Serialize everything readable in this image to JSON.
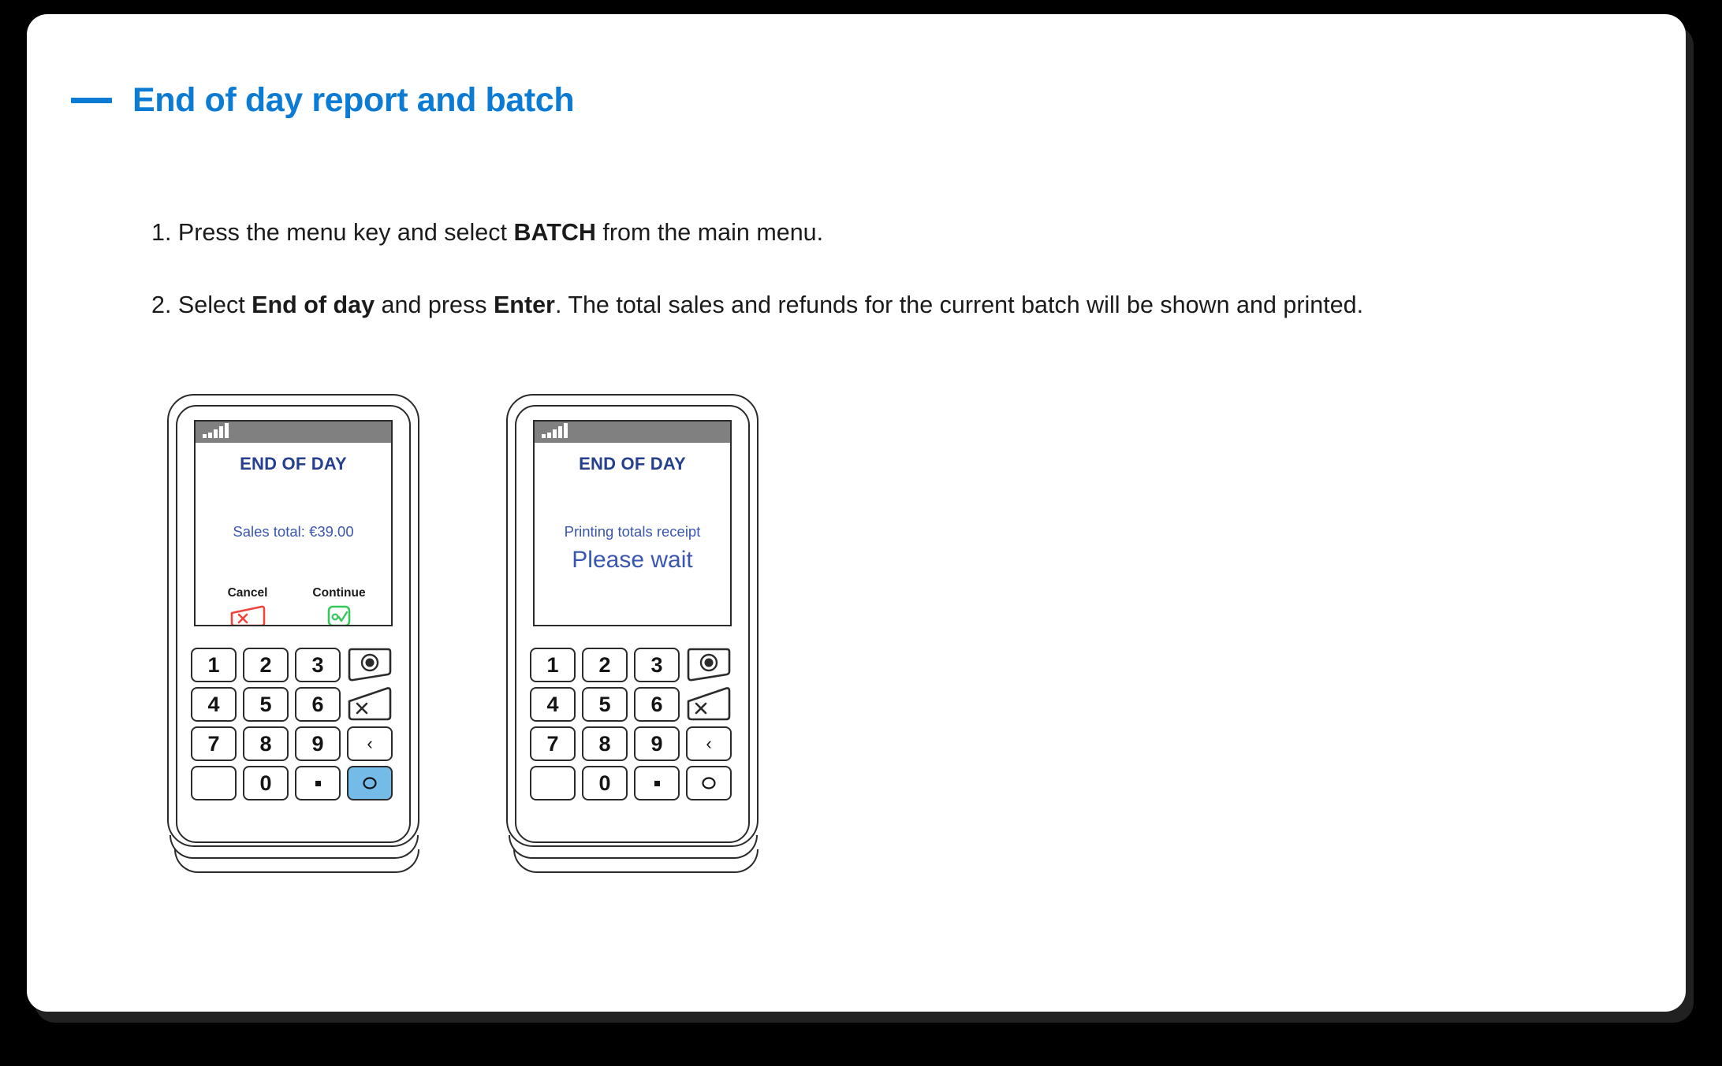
{
  "page": {
    "heading": "End of day report and batch",
    "accent_color": "#0b7bd4",
    "steps": [
      {
        "id": "step-1",
        "parts": [
          {
            "text": "1. Press the menu key and select ",
            "bold": false
          },
          {
            "text": "BATCH",
            "bold": true
          },
          {
            "text": " from the main menu.",
            "bold": false
          }
        ]
      },
      {
        "id": "step-2",
        "parts": [
          {
            "text": "2. Select ",
            "bold": false
          },
          {
            "text": "End of day",
            "bold": true
          },
          {
            "text": " and press ",
            "bold": false
          },
          {
            "text": "Enter",
            "bold": true
          },
          {
            "text": ". The total sales and refunds for the current batch will be shown and printed.",
            "bold": false
          }
        ]
      }
    ]
  },
  "terminals": [
    {
      "id": "terminal-1",
      "screen": {
        "title": "END OF DAY",
        "line1": "Sales total: €39.00",
        "bigline": "",
        "title_color": "#24408e",
        "text_color": "#3a56b0",
        "statusbar_color": "#808080",
        "signal_icon": "signal-bars-icon"
      },
      "softkeys": [
        {
          "label": "Cancel",
          "icon": "cancel-key-icon",
          "color": "#f0443c"
        },
        {
          "label": "Continue",
          "icon": "continue-key-icon",
          "color": "#35c759"
        }
      ],
      "keypad": {
        "keys": [
          "1",
          "2",
          "3",
          "",
          "4",
          "5",
          "6",
          "",
          "7",
          "8",
          "9",
          "",
          "",
          "0",
          ".",
          ""
        ],
        "func_keys": [
          "menu-key",
          "cancel-key",
          "backspace-key",
          "enter-key"
        ],
        "enter_highlighted": true,
        "enter_highlight_color": "#74bbe8"
      }
    },
    {
      "id": "terminal-2",
      "screen": {
        "title": "END OF DAY",
        "line1": "Printing totals receipt",
        "bigline": "Please wait",
        "title_color": "#24408e",
        "text_color": "#3a56b0",
        "statusbar_color": "#808080",
        "signal_icon": "signal-bars-icon"
      },
      "softkeys": [],
      "keypad": {
        "keys": [
          "1",
          "2",
          "3",
          "",
          "4",
          "5",
          "6",
          "",
          "7",
          "8",
          "9",
          "",
          "",
          "0",
          ".",
          ""
        ],
        "func_keys": [
          "menu-key",
          "cancel-key",
          "backspace-key",
          "enter-key"
        ],
        "enter_highlighted": false,
        "enter_highlight_color": ""
      }
    }
  ]
}
